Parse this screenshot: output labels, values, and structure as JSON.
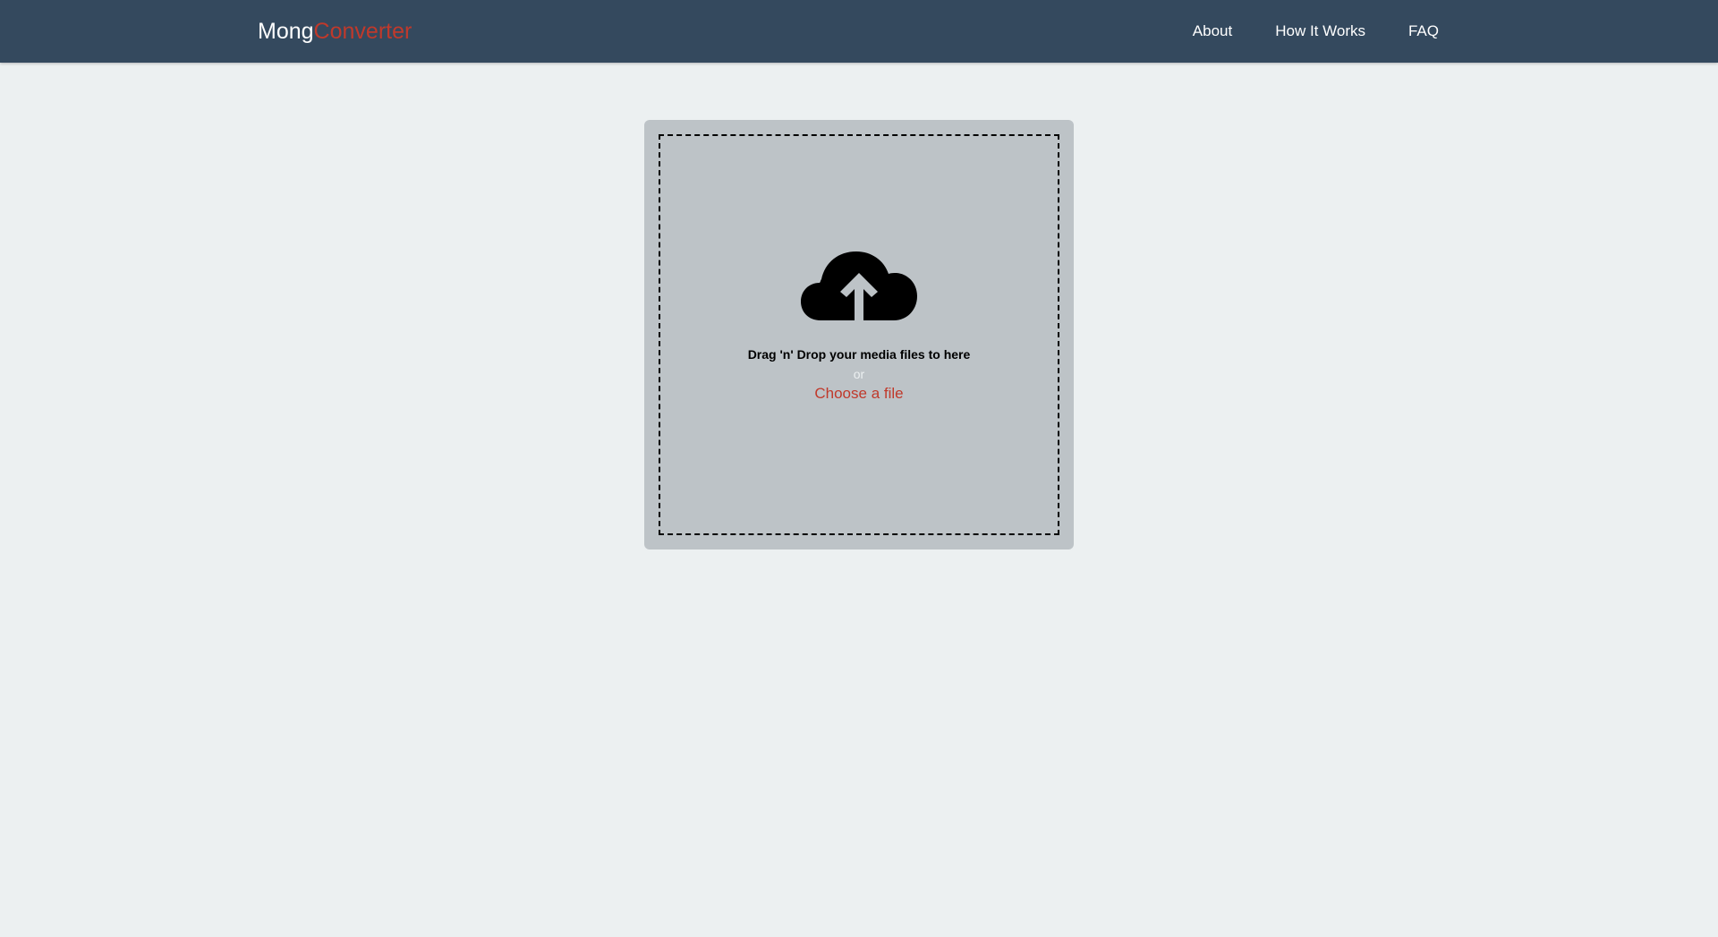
{
  "navbar": {
    "brand_main": "Mong",
    "brand_accent": "Converter",
    "links": [
      {
        "label": "About"
      },
      {
        "label": "How It Works"
      },
      {
        "label": "FAQ"
      }
    ]
  },
  "upload": {
    "icon": "cloud-upload-icon",
    "drop_text": "Drag 'n' Drop your media files to here",
    "or_text": "or",
    "choose_label": "Choose a file"
  },
  "colors": {
    "navbar_bg": "#34495e",
    "accent": "#c0392b",
    "page_bg": "#ecf0f1",
    "card_bg": "#bdc3c7"
  }
}
